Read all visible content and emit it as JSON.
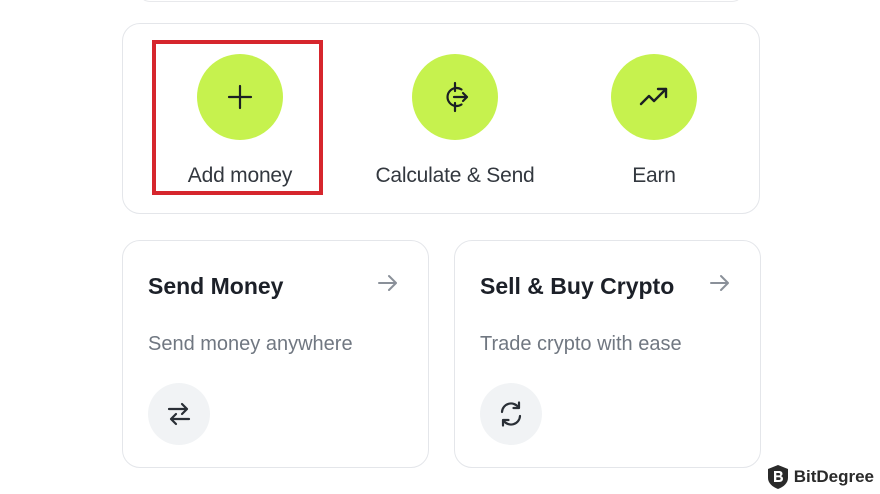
{
  "colors": {
    "accent": "#c6f24e",
    "highlight": "#d6262d",
    "icon_bubble": "#f1f3f5"
  },
  "quick_actions": [
    {
      "label": "Add money",
      "icon": "plus-icon"
    },
    {
      "label": "Calculate & Send",
      "icon": "calculate-send-icon"
    },
    {
      "label": "Earn",
      "icon": "trend-up-icon"
    }
  ],
  "cards": [
    {
      "title": "Send Money",
      "subtitle": "Send money anywhere",
      "arrow_icon": "arrow-right-icon",
      "icon": "swap-arrows-icon"
    },
    {
      "title": "Sell & Buy Crypto",
      "subtitle": "Trade crypto with ease",
      "arrow_icon": "arrow-right-icon",
      "icon": "refresh-icon"
    }
  ],
  "watermark": {
    "text": "BitDegree",
    "icon": "bitdegree-logo-icon"
  }
}
